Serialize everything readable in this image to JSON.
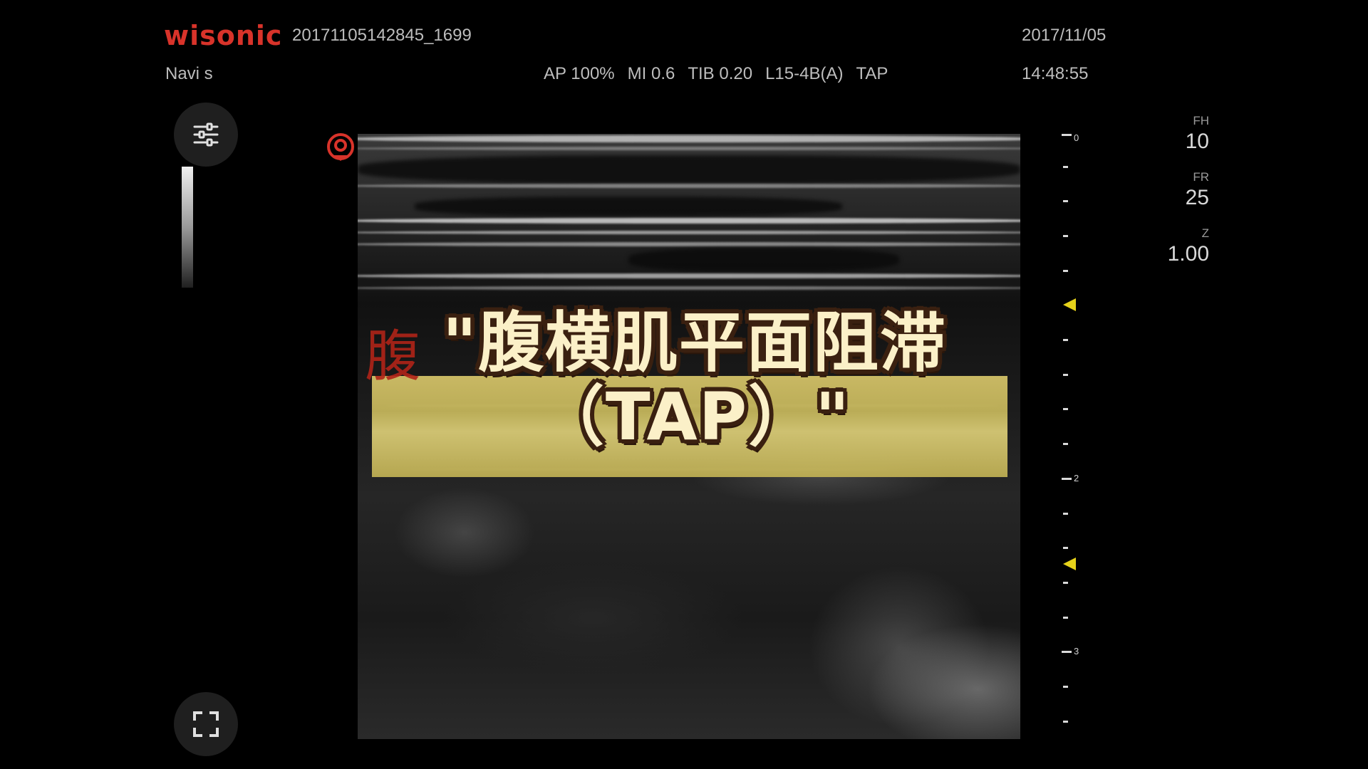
{
  "header": {
    "brand": "wisonic",
    "study_id": "20171105142845_1699",
    "date": "2017/11/05",
    "time": "14:48:55",
    "device": "Navi s",
    "params": [
      "AP 100%",
      "MI 0.6",
      "TIB 0.20",
      "L15-4B(A)",
      "TAP"
    ]
  },
  "controls": {
    "settings_icon": "sliders-icon",
    "fullscreen_icon": "fullscreen-icon",
    "probe_icon": "probe-marker-icon"
  },
  "overlay": {
    "ghost_label": "腹",
    "caption_line1": "\"腹横肌平面阻滞",
    "caption_line2": "（TAP）\"",
    "highlight_color": "#d8c66a",
    "caption_color": "#fbf0c8"
  },
  "depth_scale": {
    "labels": [
      "0",
      "2",
      "3"
    ],
    "marker_color": "#e6d21a"
  },
  "readouts": [
    {
      "label": "FH",
      "value": "10"
    },
    {
      "label": "FR",
      "value": "25"
    },
    {
      "label": "Z",
      "value": "1.00"
    }
  ],
  "colors": {
    "brand": "#d8332a",
    "text": "#bdbdbd",
    "background": "#000000"
  }
}
